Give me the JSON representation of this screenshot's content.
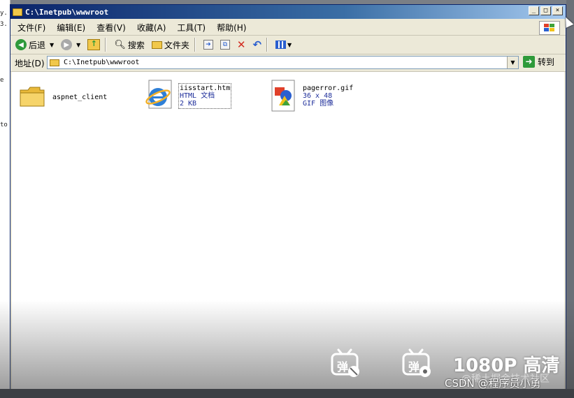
{
  "desktop_fragments": [
    "y.",
    "3.",
    "e",
    "to"
  ],
  "window": {
    "title": "C:\\Inetpub\\wwwroot",
    "controls": {
      "minimize": "_",
      "maximize": "□",
      "close": "×"
    }
  },
  "menu": [
    "文件(F)",
    "编辑(E)",
    "查看(V)",
    "收藏(A)",
    "工具(T)",
    "帮助(H)"
  ],
  "toolbar": {
    "back_label": "后退",
    "search_label": "搜索",
    "folders_label": "文件夹"
  },
  "address": {
    "label": "地址(D)",
    "value": "C:\\Inetpub\\wwwroot",
    "go_label": "转到"
  },
  "files": [
    {
      "name": "aspnet_client",
      "type": "",
      "size": ""
    },
    {
      "name": "iisstart.htm",
      "type": "HTML 文档",
      "size": "2 KB"
    },
    {
      "name": "pagerror.gif",
      "type": "36 x 48",
      "size": "GIF 图像"
    }
  ],
  "overlay": {
    "quality": "1080P 高清",
    "watermark_back": "@稀土掘金技术社区",
    "watermark_front": "CSDN @程序员小勇",
    "danmaku_glyph": "弹"
  },
  "colors": {
    "title_start": "#0a246a",
    "title_end": "#a6caf0",
    "chrome": "#ece9d8",
    "file_blue": "#1e2e9a"
  }
}
